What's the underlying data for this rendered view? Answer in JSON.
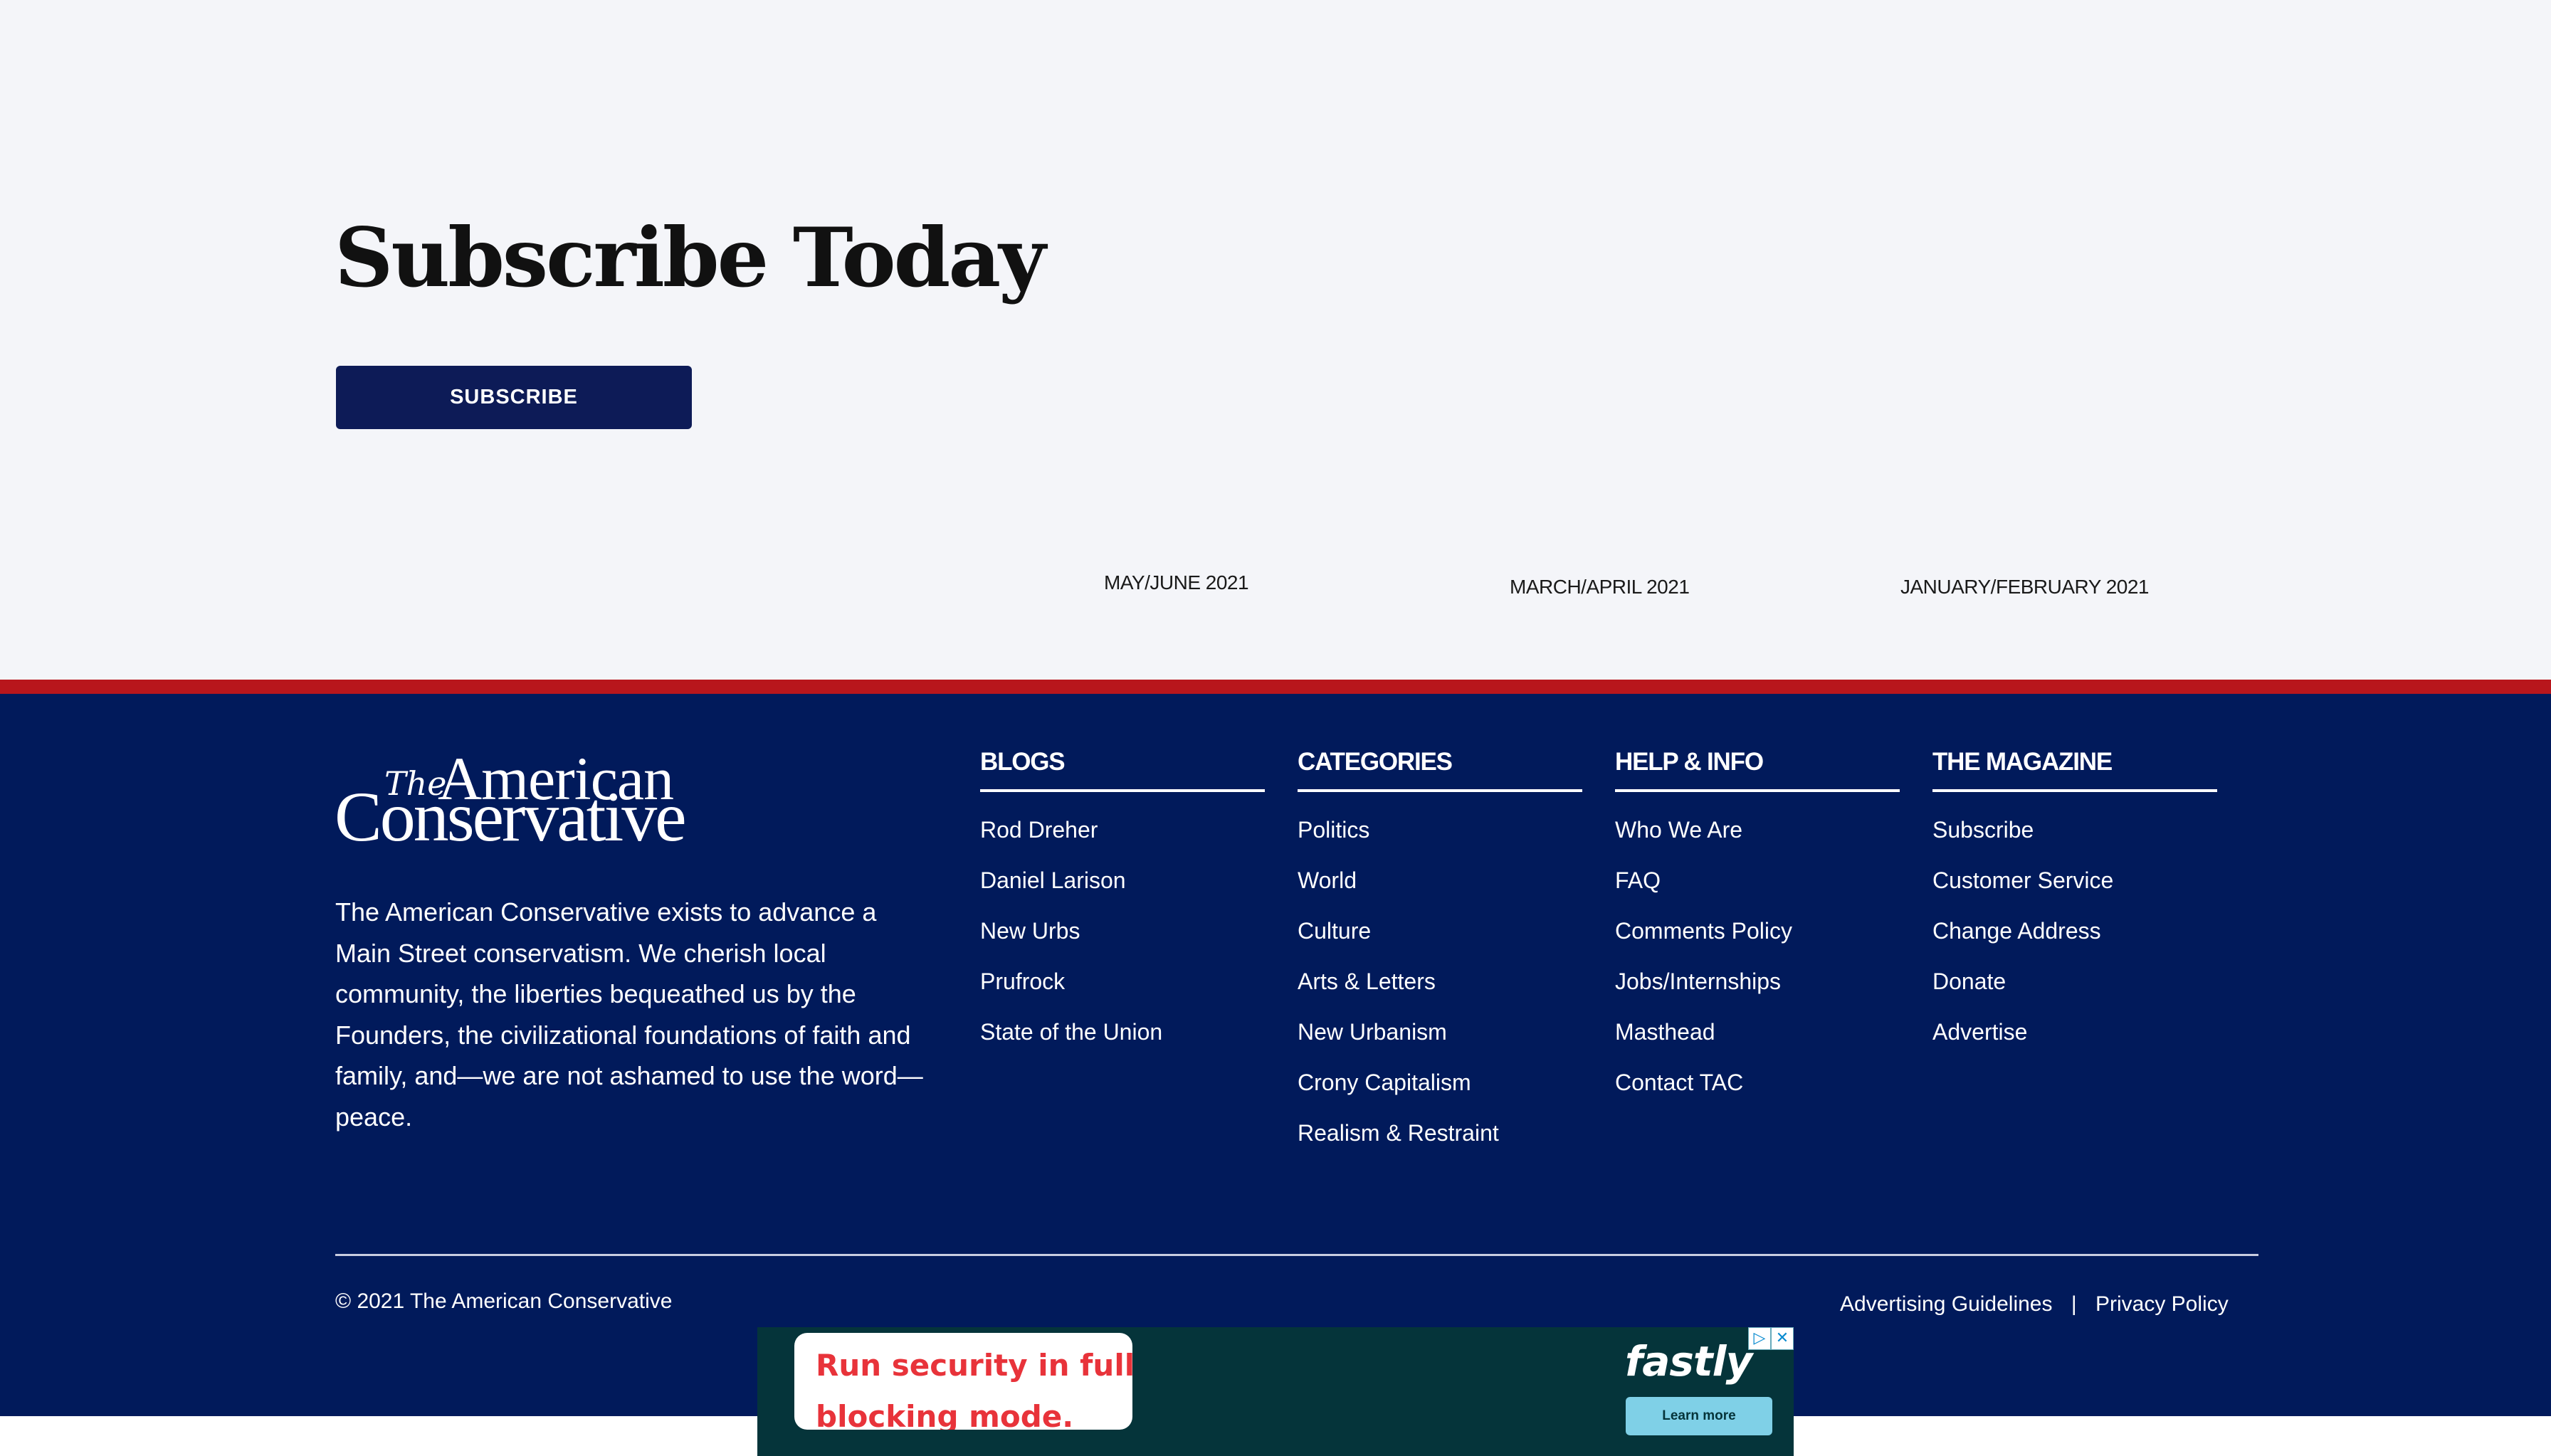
{
  "subscribe_section": {
    "title": "Subscribe Today",
    "button_label": "SUBSCRIBE",
    "issues": [
      "MAY/JUNE 2021",
      "MARCH/APRIL 2021",
      "JANUARY/FEBRUARY 2021"
    ]
  },
  "footer": {
    "logo": {
      "the": "The",
      "american": "American",
      "conservative": "Conservative"
    },
    "mission": "The American Conservative exists to advance a Main Street conservatism. We cherish local community, the liberties bequeathed us by the Founders, the civilizational foundations of faith and family, and—we are not ashamed to use the word—peace.",
    "columns": [
      {
        "heading": "BLOGS",
        "links": [
          "Rod Dreher",
          "Daniel Larison",
          "New Urbs",
          "Prufrock",
          "State of the Union"
        ]
      },
      {
        "heading": "CATEGORIES",
        "links": [
          "Politics",
          "World",
          "Culture",
          "Arts & Letters",
          "New Urbanism",
          "Crony Capitalism",
          "Realism & Restraint"
        ]
      },
      {
        "heading": "HELP & INFO",
        "links": [
          "Who We Are",
          "FAQ",
          "Comments Policy",
          "Jobs/Internships",
          "Masthead",
          "Contact TAC"
        ]
      },
      {
        "heading": "THE MAGAZINE",
        "links": [
          "Subscribe",
          "Customer Service",
          "Change Address",
          "Donate",
          "Advertise"
        ]
      }
    ],
    "copyright": "© 2021 The American Conservative",
    "legal_links": [
      "Advertising Guidelines",
      "Privacy Policy"
    ],
    "legal_separator": "|"
  },
  "ad": {
    "headline_line1": "Run security in full",
    "headline_line2": "blocking mode.",
    "brand": "fastly",
    "cta": "Learn more",
    "adchoices_icon": "play-triangle-icon",
    "close_icon": "close-icon"
  },
  "colors": {
    "page_bg": "#f4f5f9",
    "navy": "#011a5b",
    "button_navy": "#0d1b57",
    "red_rule": "#b8161c",
    "ad_bg": "#05343a",
    "ad_red": "#e8333a",
    "ad_cta": "#7fd0e7"
  }
}
